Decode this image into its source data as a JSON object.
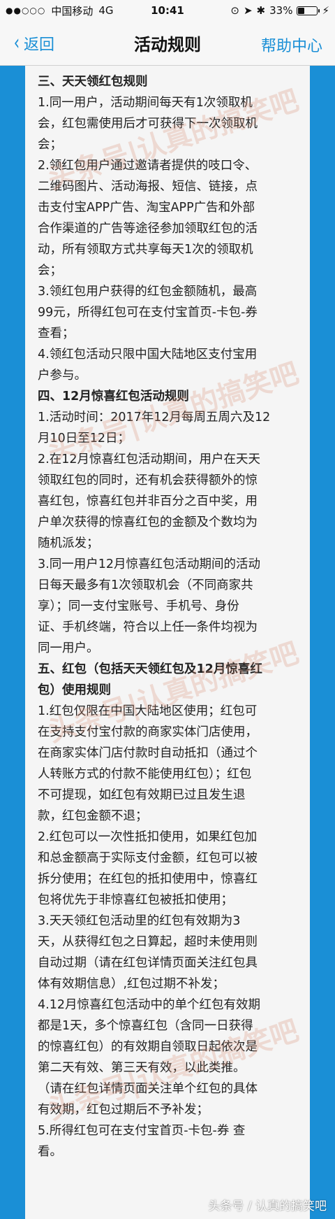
{
  "status_bar": {
    "signal": "●●○○○",
    "carrier": "中国移动",
    "network": "4G",
    "time": "10:41",
    "battery_percent": "33%",
    "battery_level": 0.33
  },
  "nav": {
    "back_label": "返回",
    "back_icon": "chevron-left-icon",
    "title": "活动规则",
    "help_label": "帮助中心"
  },
  "rules": [
    {
      "text": "三、天天领红包规则",
      "heading": true
    },
    {
      "text": "1.同一用户，活动期间每天有1次领取机"
    },
    {
      "text": "会，红包需使用后才可获得下一次领取机"
    },
    {
      "text": "会；"
    },
    {
      "text": "2.领红包用户通过邀请者提供的吱口令、"
    },
    {
      "text": "二维码图片、活动海报、短信、链接，点"
    },
    {
      "text": "击支付宝APP广告、淘宝APP广告和外部"
    },
    {
      "text": "合作渠道的广告等途径参加领取红包的活"
    },
    {
      "text": "动，所有领取方式共享每天1次的领取机"
    },
    {
      "text": "会；"
    },
    {
      "text": "3.领红包用户获得的红包金额随机，最高"
    },
    {
      "text": "99元，所得红包可在支付宝首页-卡包-券"
    },
    {
      "text": "查看；"
    },
    {
      "text": "4.领红包活动只限中国大陆地区支付宝用"
    },
    {
      "text": "户参与。"
    },
    {
      "text": " 四、12月惊喜红包活动规则",
      "heading": true
    },
    {
      "text": "1.活动时间：2017年12月每周五周六及12"
    },
    {
      "text": "月10日至12日；"
    },
    {
      "text": "2.在12月惊喜红包活动期间，用户在天天"
    },
    {
      "text": "领取红包的同时，还有机会获得额外的惊"
    },
    {
      "text": "喜红包，惊喜红包并非百分之百中奖，用"
    },
    {
      "text": "户单次获得的惊喜红包的金额及个数均为"
    },
    {
      "text": "随机派发；"
    },
    {
      "text": "3.同一用户12月惊喜红包活动期间的活动"
    },
    {
      "text": "日每天最多有1次领取机会（不同商家共"
    },
    {
      "text": "享）；同一支付宝账号、手机号、身份"
    },
    {
      "text": "证、手机终端，符合以上任一条件均视为"
    },
    {
      "text": "同一用户。"
    },
    {
      "text": "五、红包（包括天天领红包及12月惊喜红",
      "heading": true
    },
    {
      "text": "包）使用规则",
      "heading": true
    },
    {
      "text": "1.红包仅限在中国大陆地区使用；红包可"
    },
    {
      "text": "在支持支付宝付款的商家实体门店使用，"
    },
    {
      "text": "在商家实体门店付款时自动抵扣（通过个"
    },
    {
      "text": "人转账方式的付款不能使用红包）；红包"
    },
    {
      "text": "不可提现，如红包有效期已过且发生退"
    },
    {
      "text": "款，红包金额不退；"
    },
    {
      "text": "2.红包可以一次性抵扣使用，如果红包加"
    },
    {
      "text": "和总金额高于实际支付金额，红包可以被"
    },
    {
      "text": "拆分使用；在红包的抵扣使用中，惊喜红"
    },
    {
      "text": "包将优先于非惊喜红包被抵扣使用；"
    },
    {
      "text": "3.天天领红包活动里的红包有效期为3"
    },
    {
      "text": "天，从获得红包之日算起，超时未使用则"
    },
    {
      "text": "自动过期（请在红包详情页面关注红包具"
    },
    {
      "text": "体有效期信息）,红包过期不补发；"
    },
    {
      "text": "4.12月惊喜红包活动中的单个红包有效期"
    },
    {
      "text": "都是1天，多个惊喜红包（含同一日获得"
    },
    {
      "text": "的惊喜红包）的有效期自领取日起依次是"
    },
    {
      "text": "第二天有效、第三天有效，以此类推。"
    },
    {
      "text": "（请在红包详情页面关注单个红包的具体"
    },
    {
      "text": "有效期，红包过期后不予补发；"
    },
    {
      "text": "5.所得红包可在支付宝首页-卡包-券 查"
    },
    {
      "text": "看。"
    }
  ],
  "watermarks": [
    "头条号|认真的搞笑吧",
    "头条号|认真的搞笑吧",
    "头条号|认真的搞笑吧",
    "头条号|认真的搞笑吧"
  ],
  "footer_credit": "头条号 / 认真的搞笑吧",
  "colors": {
    "accent": "#1a8fd6",
    "content_bg": "#f5f5f5",
    "text": "#222222"
  }
}
